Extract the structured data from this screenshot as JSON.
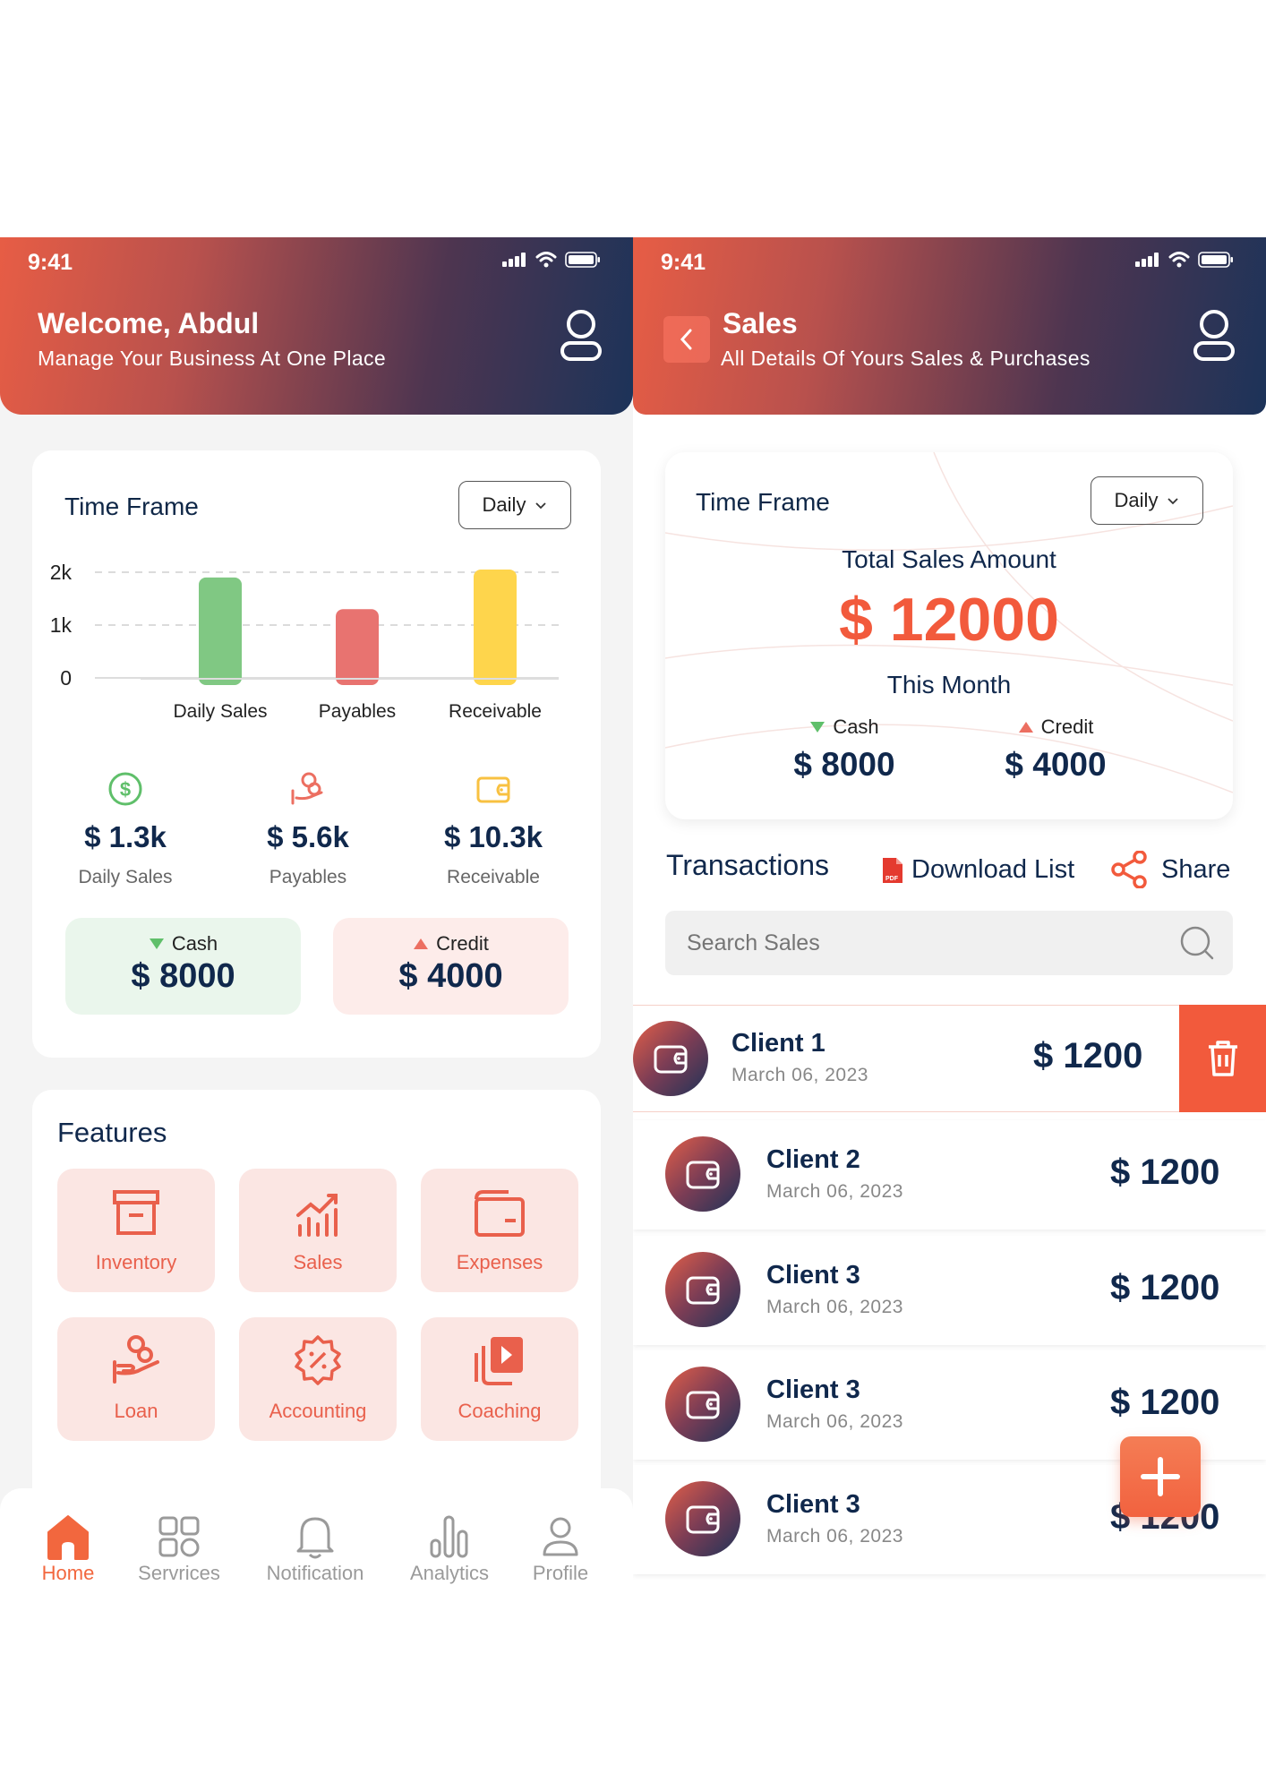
{
  "left_screen": {
    "status_time": "9:41",
    "header": {
      "title": "Welcome, Abdul",
      "subtitle": "Manage Your Business At One Place"
    },
    "time_frame": {
      "label": "Time Frame",
      "dropdown_value": "Daily"
    },
    "chart_data": {
      "type": "bar",
      "categories": [
        "Daily Sales",
        "Payables",
        "Receivable"
      ],
      "values": [
        1.9,
        1.3,
        2.05
      ],
      "yticks": [
        "2k",
        "1k",
        "0"
      ],
      "ylim": [
        0,
        2
      ],
      "colors": [
        "#80c883",
        "#e87370",
        "#fed54c"
      ],
      "grid": true
    },
    "metrics": [
      {
        "value": "$ 1.3k",
        "label": "Daily Sales",
        "icon": "dollar-circle-icon"
      },
      {
        "value": "$ 5.6k",
        "label": "Payables",
        "icon": "coins-hand-icon"
      },
      {
        "value": "$ 10.3k",
        "label": "Receivable",
        "icon": "wallet-icon"
      }
    ],
    "cash": {
      "label": "Cash",
      "value": "$ 8000"
    },
    "credit": {
      "label": "Credit",
      "value": "$ 4000"
    },
    "features": {
      "title": "Features",
      "items": [
        {
          "label": "Inventory",
          "icon": "archive-box-icon"
        },
        {
          "label": "Sales",
          "icon": "chart-up-icon"
        },
        {
          "label": "Expenses",
          "icon": "wallet-icon"
        },
        {
          "label": "Loan",
          "icon": "coins-hand-icon"
        },
        {
          "label": "Accounting",
          "icon": "percent-badge-icon"
        },
        {
          "label": "Coaching",
          "icon": "video-play-icon"
        }
      ]
    },
    "nav": [
      {
        "label": "Home",
        "icon": "home-icon",
        "active": true
      },
      {
        "label": "Servrices",
        "icon": "grid-icon",
        "active": false
      },
      {
        "label": "Notification",
        "icon": "bell-icon",
        "active": false
      },
      {
        "label": "Analytics",
        "icon": "analytics-icon",
        "active": false
      },
      {
        "label": "Profile",
        "icon": "user-icon",
        "active": false
      }
    ]
  },
  "right_screen": {
    "status_time": "9:41",
    "header": {
      "title": "Sales",
      "subtitle": "All Details Of Yours Sales & Purchases"
    },
    "time_frame": {
      "label": "Time Frame",
      "dropdown_value": "Daily"
    },
    "total": {
      "label": "Total Sales Amount",
      "value": "$ 12000",
      "period": "This Month"
    },
    "cash": {
      "label": "Cash",
      "value": "$ 8000"
    },
    "credit": {
      "label": "Credit",
      "value": "$ 4000"
    },
    "transactions": {
      "title": "Transactions",
      "download_label": "Download List",
      "share_label": "Share",
      "pdf_badge": "PDF"
    },
    "search": {
      "placeholder": "Search Sales"
    },
    "clients": [
      {
        "name": "Client 1",
        "date": "March 06, 2023",
        "amount": "$ 1200"
      },
      {
        "name": "Client 2",
        "date": "March 06, 2023",
        "amount": "$ 1200"
      },
      {
        "name": "Client 3",
        "date": "March 06, 2023",
        "amount": "$ 1200"
      },
      {
        "name": "Client 3",
        "date": "March 06, 2023",
        "amount": "$ 1200"
      },
      {
        "name": "Client 3",
        "date": "March 06, 2023",
        "amount": "$ 1200"
      }
    ],
    "colors": {
      "accent": "#f25a3c",
      "navy": "#10284c"
    }
  }
}
